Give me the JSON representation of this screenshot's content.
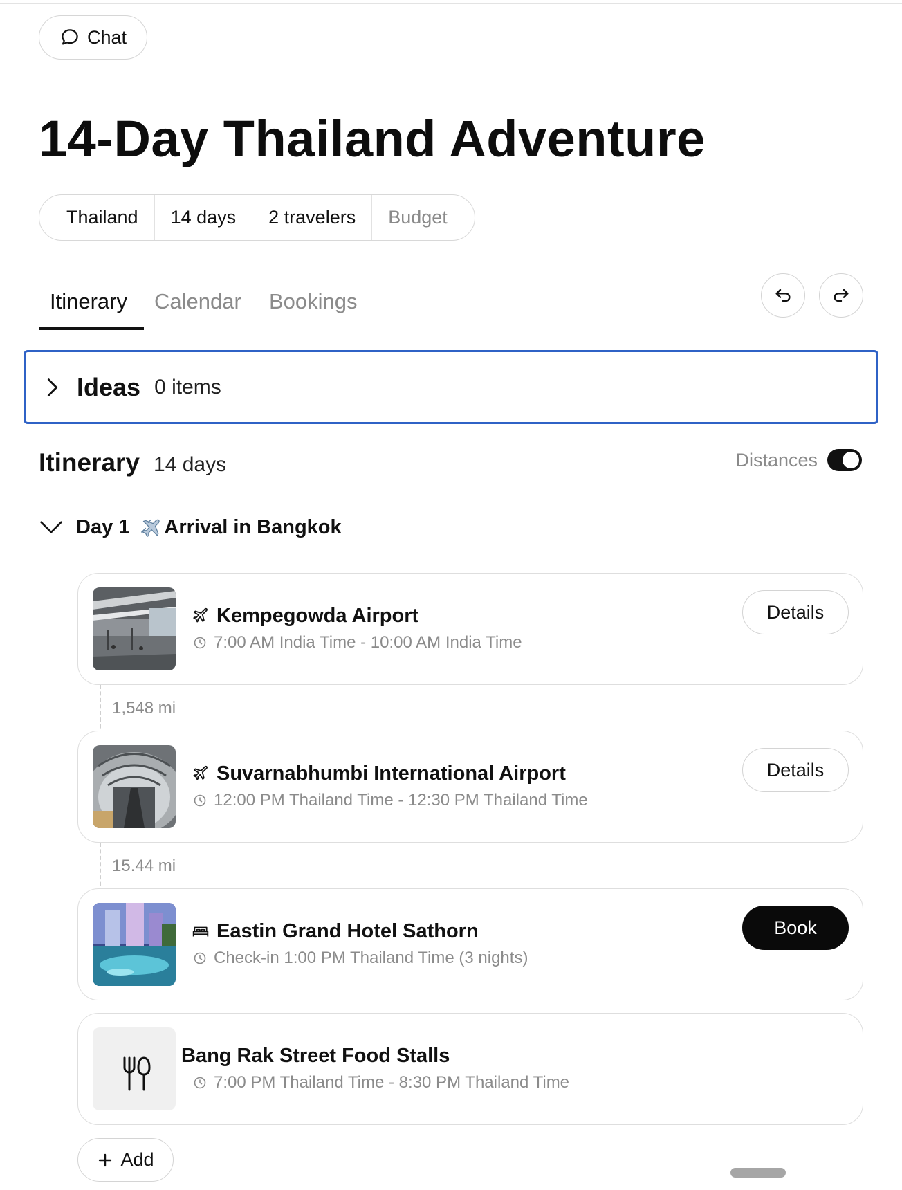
{
  "chat_button": {
    "label": "Chat",
    "icon": "chat-bubble-icon"
  },
  "trip": {
    "title": "14-Day Thailand Adventure",
    "meta": [
      "Thailand",
      "14 days",
      "2 travelers",
      "Budget"
    ]
  },
  "tabs": [
    {
      "label": "Itinerary",
      "active": true
    },
    {
      "label": "Calendar",
      "active": false
    },
    {
      "label": "Bookings",
      "active": false
    }
  ],
  "history": {
    "undo_icon": "undo-icon",
    "redo_icon": "redo-icon"
  },
  "ideas": {
    "title": "Ideas",
    "count": "0 items",
    "expanded": false
  },
  "itinerary": {
    "title": "Itinerary",
    "duration": "14 days",
    "distances_label": "Distances",
    "distances_on": true
  },
  "day1": {
    "label": "Day 1",
    "emoji": "✈️",
    "title": "Arrival in Bangkok",
    "items": [
      {
        "title": "Kempegowda Airport",
        "icon": "plane-icon",
        "subtitle": "7:00 AM India Time - 10:00 AM India Time",
        "action": "Details"
      },
      {
        "title": "Suvarnabhumbi International Airport",
        "icon": "plane-icon",
        "subtitle": "12:00 PM Thailand Time - 12:30 PM Thailand Time",
        "action": "Details"
      },
      {
        "title": "Eastin Grand Hotel Sathorn",
        "icon": "bed-icon",
        "subtitle": "Check-in 1:00 PM Thailand Time (3 nights)",
        "action": "Book"
      },
      {
        "title": "Bang Rak Street Food Stalls",
        "icon": "utensils-icon",
        "subtitle": "7:00 PM Thailand Time - 8:30 PM Thailand Time"
      }
    ],
    "distances": [
      "1,548 mi",
      "15.44 mi"
    ]
  },
  "add_button": {
    "label": "Add"
  },
  "colors": {
    "accent_border": "#2f62c6",
    "primary_dark": "#0a0a0a",
    "muted_text": "#8b8b8b"
  }
}
